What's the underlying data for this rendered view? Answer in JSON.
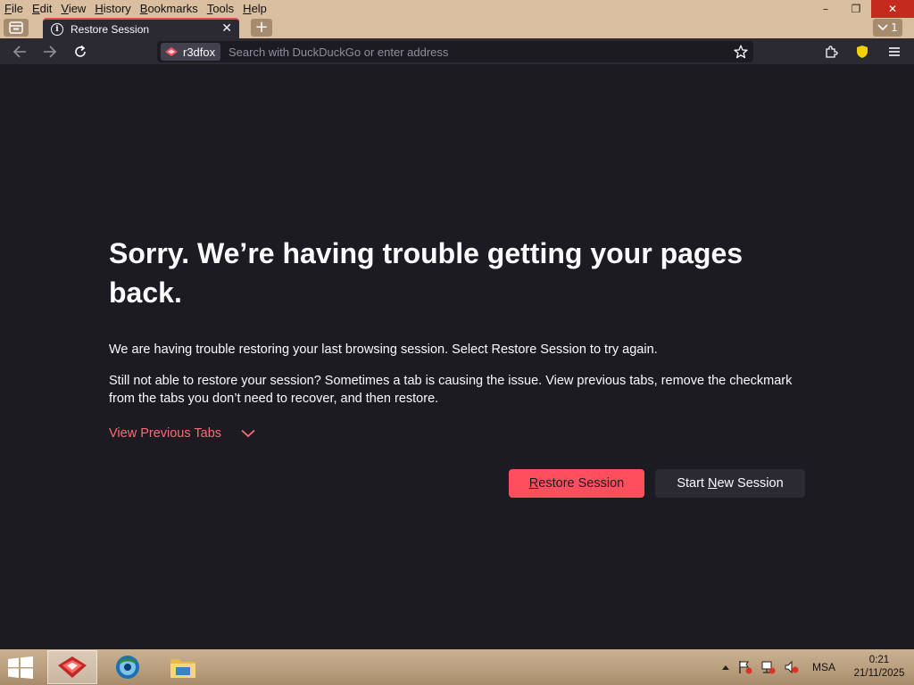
{
  "menubar": {
    "items": [
      "File",
      "Edit",
      "View",
      "History",
      "Bookmarks",
      "Tools",
      "Help"
    ]
  },
  "window_controls": {
    "minimize": "–",
    "restore": "❐",
    "close": "✕"
  },
  "tabs": {
    "active_title": "Restore Session",
    "close_glyph": "✕",
    "new_tab_glyph": "+",
    "tab_count": "1"
  },
  "urlbar": {
    "identity_label": "r3dfox",
    "placeholder": "Search with DuckDuckGo or enter address"
  },
  "content": {
    "headline": "Sorry. We’re having trouble getting your pages back.",
    "paragraph1": "We are having trouble restoring your last browsing session. Select Restore Session to try again.",
    "paragraph2": "Still not able to restore your session? Sometimes a tab is causing the issue. View previous tabs, remove the checkmark from the tabs you don’t need to recover, and then restore.",
    "view_previous_tabs": "View Previous Tabs",
    "restore_button": "Restore Session",
    "new_session_prefix": "Start ",
    "new_session_underlined": "N",
    "new_session_suffix": "ew Session"
  },
  "taskbar": {
    "language": "MSA",
    "time": "0:21",
    "date": "21/11/2025"
  },
  "colors": {
    "content_bg": "#1c1b22",
    "toolbar_bg": "#2b2a33",
    "accent_red": "#ff4f5e",
    "link_red": "#ff6a75",
    "chrome_tan": "#d9bfa0"
  }
}
